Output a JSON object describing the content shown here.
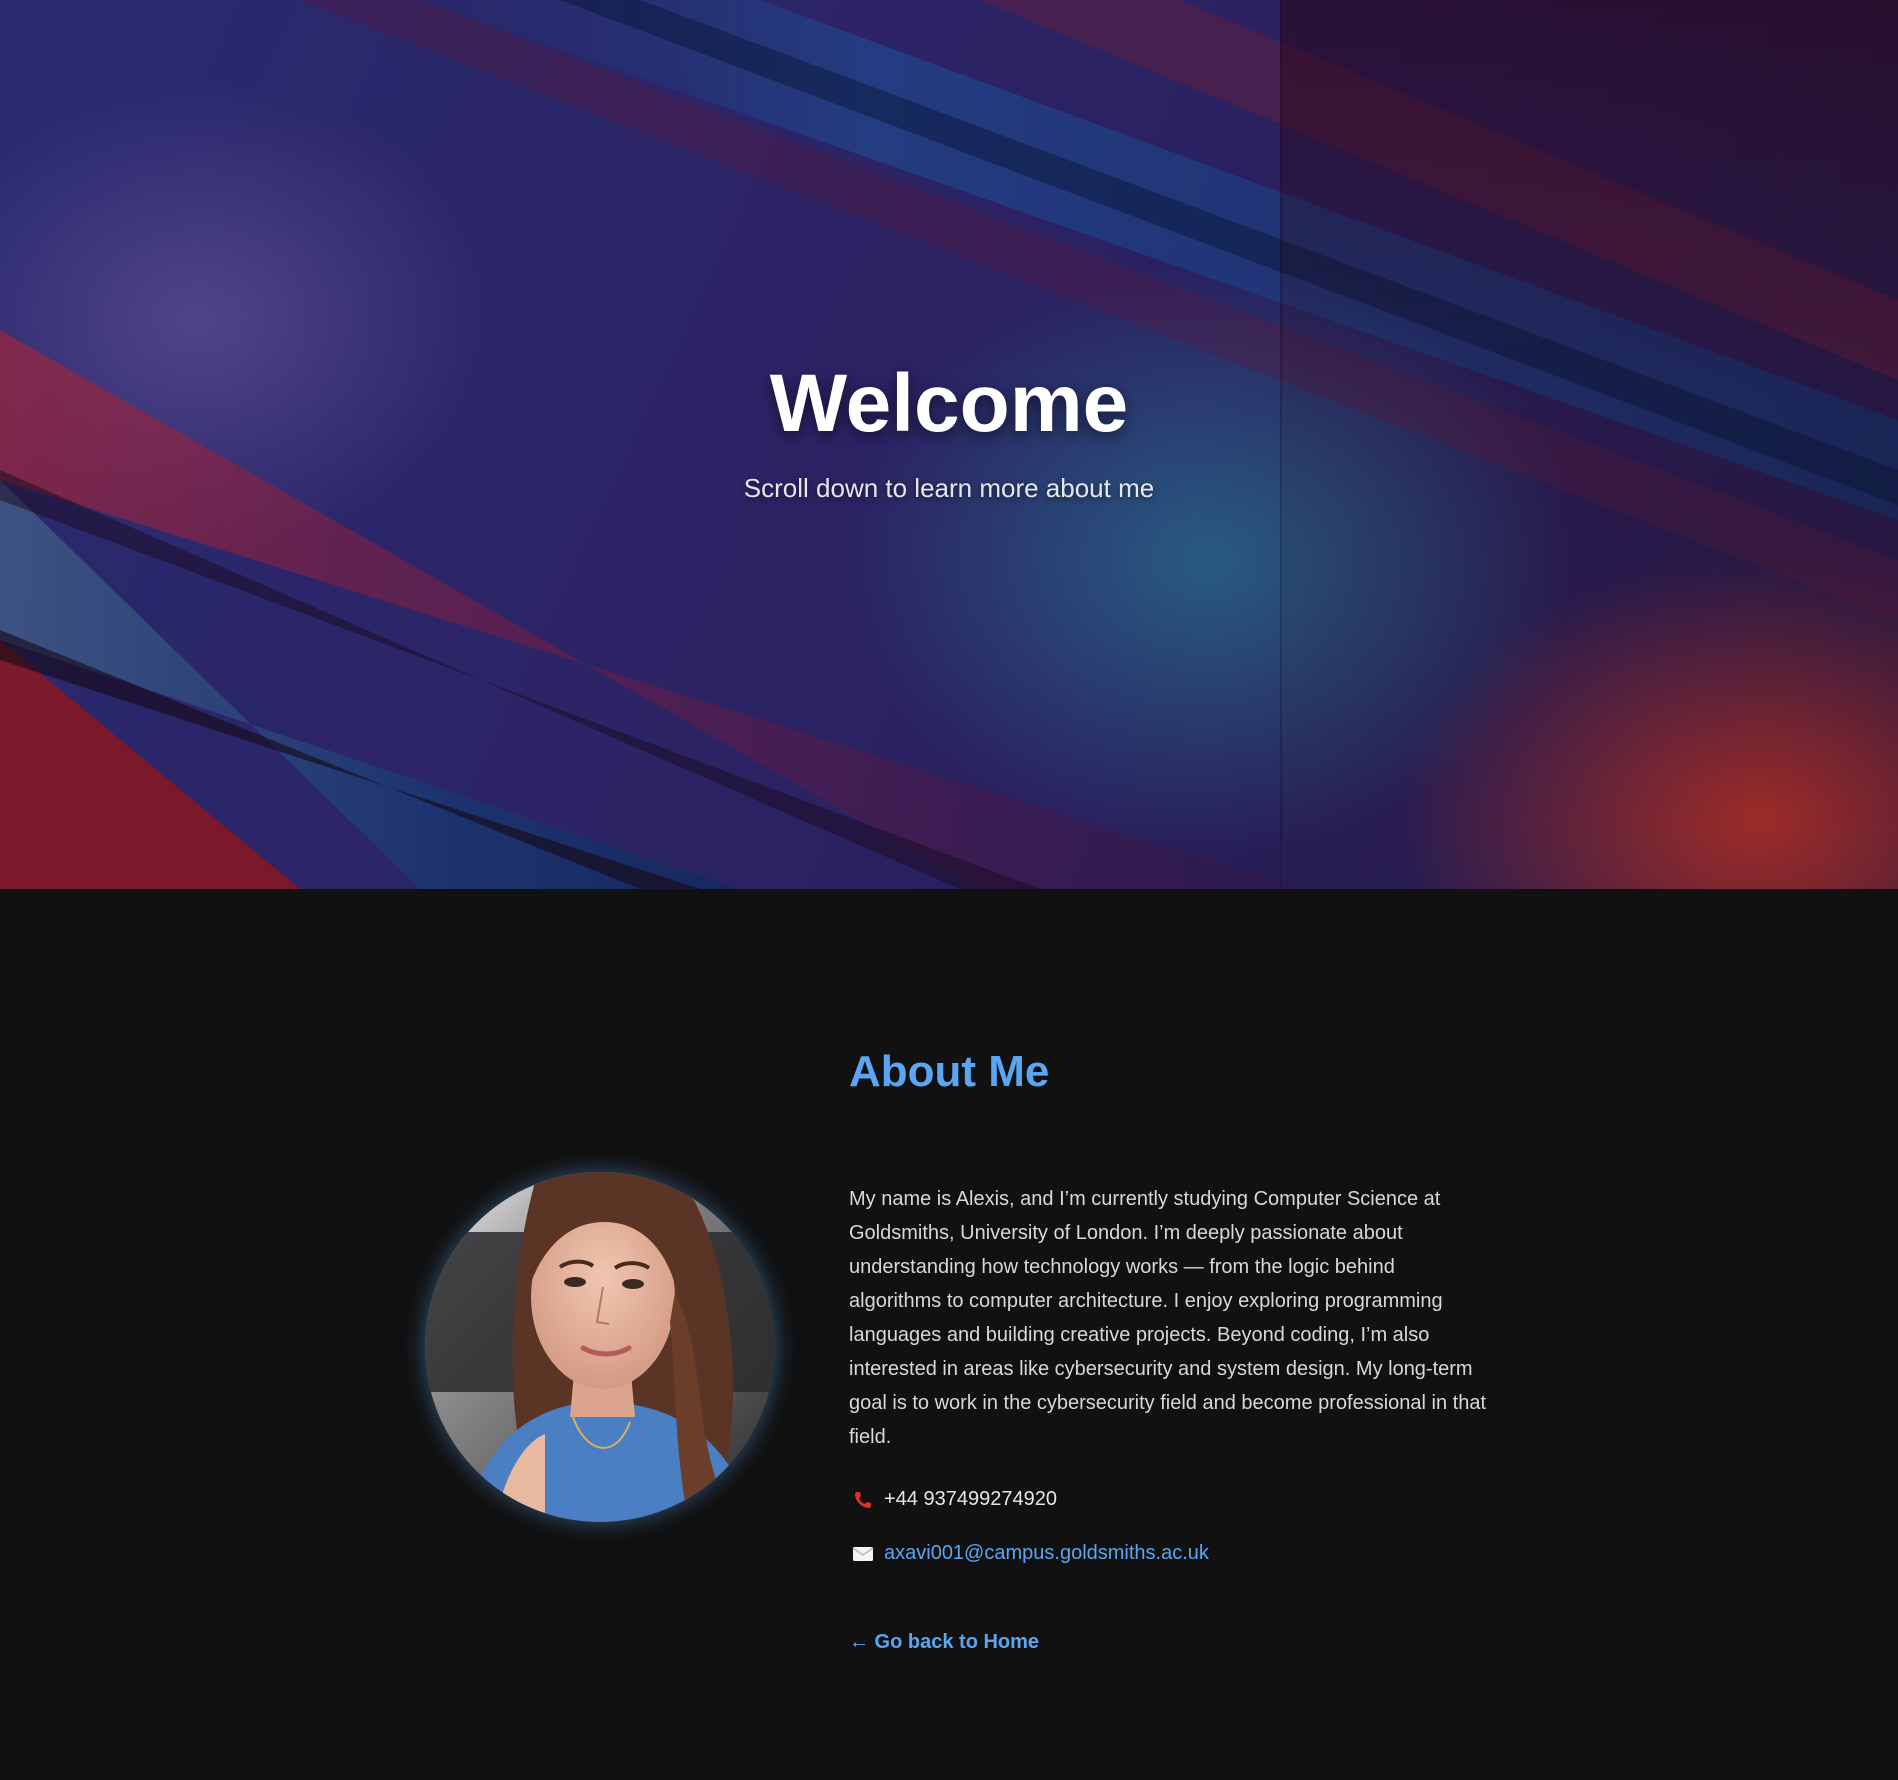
{
  "hero": {
    "title": "Welcome",
    "subtitle": "Scroll down to learn more about me"
  },
  "about": {
    "title": "About Me",
    "photo_icon": "profile-photo",
    "bio": "My name is Alexis, and I’m currently studying Computer Science at Goldsmiths, University of London. I’m deeply passionate about understanding how technology works — from the logic behind algorithms to computer architecture. I enjoy exploring programming languages and building creative projects. Beyond coding, I’m also interested in areas like cybersecurity and system design. My long-term goal is to work in the cybersecurity field and become professional in that field.",
    "phone": {
      "icon": "phone-icon",
      "value": "+44 937499274920"
    },
    "email": {
      "icon": "envelope-icon",
      "value": "axavi001@campus.goldsmiths.ac.uk"
    },
    "back_link": "← Go back to Home"
  },
  "colors": {
    "accent": "#5aa6f2",
    "background": "#111111",
    "text": "#d8d8d8"
  }
}
